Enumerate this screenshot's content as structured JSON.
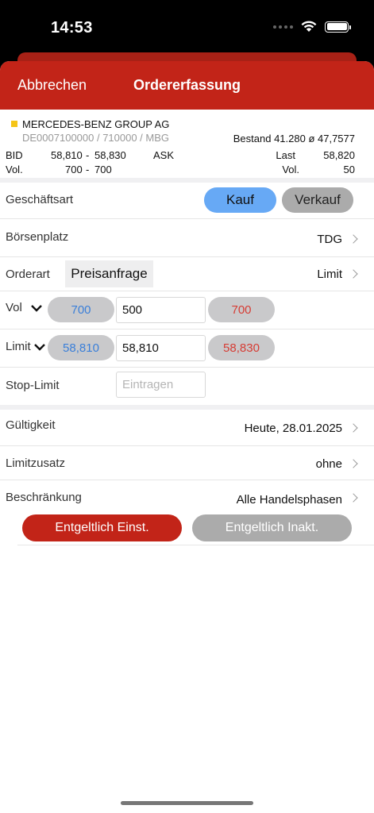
{
  "status": {
    "time": "14:53"
  },
  "nav": {
    "cancel": "Abbrechen",
    "title": "Ordererfassung"
  },
  "instrument": {
    "name": "MERCEDES-BENZ GROUP AG",
    "isin": "DE0007100000 / 710000 / MBG",
    "bestand": "Bestand 41.280 ø 47,7577",
    "bid_label": "BID",
    "bid": "58,810",
    "sep": "-",
    "ask": "58,830",
    "ask_label": "ASK",
    "vol_label": "Vol.",
    "bid_vol": "700",
    "ask_vol": "700",
    "last_label": "Last",
    "last": "58,820",
    "last_vol_label": "Vol.",
    "last_vol": "50",
    "marker_color": "#f5c518"
  },
  "form": {
    "geschaeftsart": {
      "label": "Geschäftsart",
      "buy": "Kauf",
      "sell": "Verkauf",
      "selected": "Kauf"
    },
    "boersenplatz": {
      "label": "Börsenplatz",
      "value": "TDG"
    },
    "orderart": {
      "label": "Orderart",
      "preisanfrage": "Preisanfrage",
      "value": "Limit"
    },
    "vol": {
      "label": "Vol",
      "bid": "700",
      "value": "500",
      "ask": "700"
    },
    "limit": {
      "label": "Limit",
      "bid": "58,810",
      "value": "58,810",
      "ask": "58,830"
    },
    "stoplimit": {
      "label": "Stop-Limit",
      "placeholder": "Eintragen"
    },
    "gueltigkeit": {
      "label": "Gültigkeit",
      "value": "Heute, 28.01.2025"
    },
    "limitzusatz": {
      "label": "Limitzusatz",
      "value": "ohne"
    },
    "beschraenkung": {
      "label": "Beschränkung",
      "value": "Alle Handelsphasen"
    }
  },
  "actions": {
    "primary": "Entgeltlich Einst.",
    "secondary": "Entgeltlich Inakt."
  },
  "colors": {
    "brand_red": "#c22418",
    "buy_blue": "#67a9f5",
    "bid_blue": "#3a7fd9",
    "ask_red": "#d63c34"
  }
}
